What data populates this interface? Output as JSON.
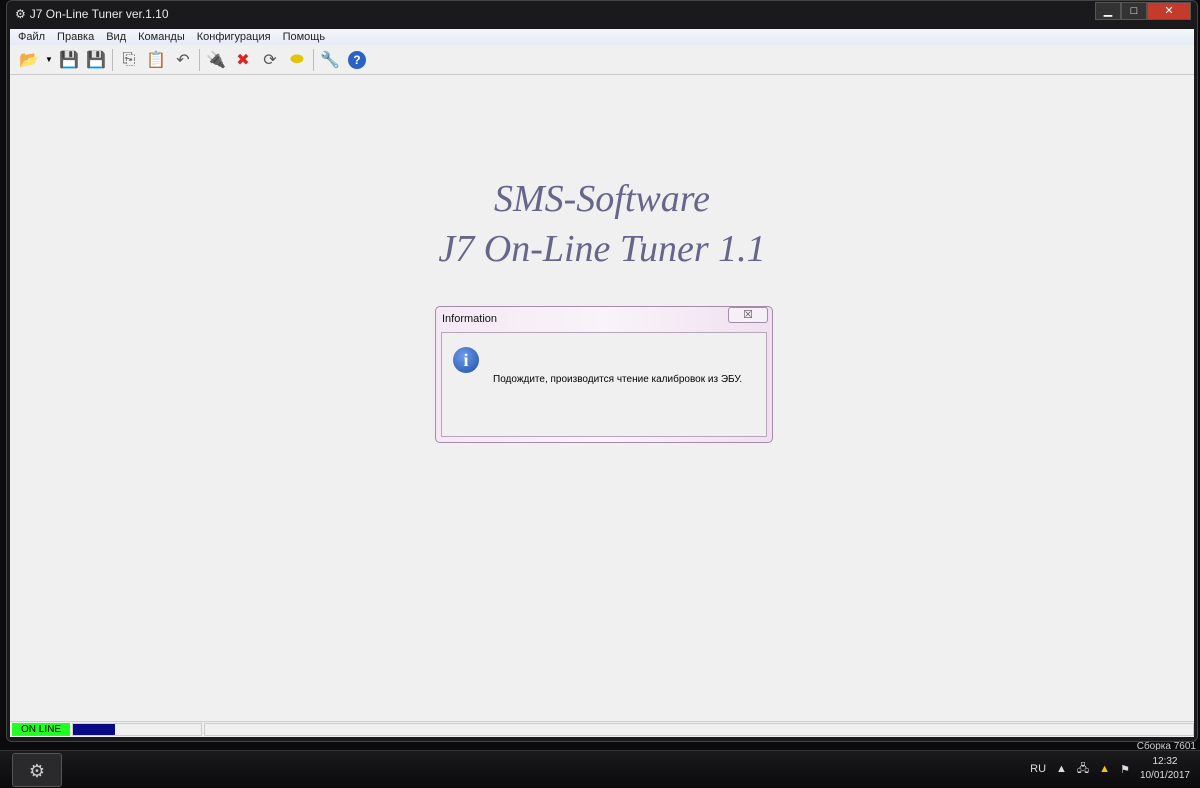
{
  "window": {
    "title": "J7 On-Line Tuner ver.1.10"
  },
  "menu": [
    "Файл",
    "Правка",
    "Вид",
    "Команды",
    "Конфигурация",
    "Помощь"
  ],
  "toolbar_icons": [
    "open-folder-icon",
    "save-icon",
    "save-as-icon",
    "copy-icon",
    "paste-icon",
    "undo-icon",
    "connect-icon",
    "disconnect-icon",
    "refresh-icon",
    "engine-icon",
    "tools-icon",
    "help-icon"
  ],
  "splash": {
    "line1": "SMS-Software",
    "line2": "J7 On-Line Tuner 1.1"
  },
  "dialog": {
    "title": "Information",
    "close": "☒",
    "message": "Подождите, производится чтение калибровок из ЭБУ."
  },
  "status": {
    "online": "ON LINE",
    "progress_percent": 33,
    "online_color": "#22ff22"
  },
  "taskbar": {
    "lang": "RU",
    "time": "12:32",
    "date": "10/01/2017",
    "build": "Сборка 7601"
  }
}
